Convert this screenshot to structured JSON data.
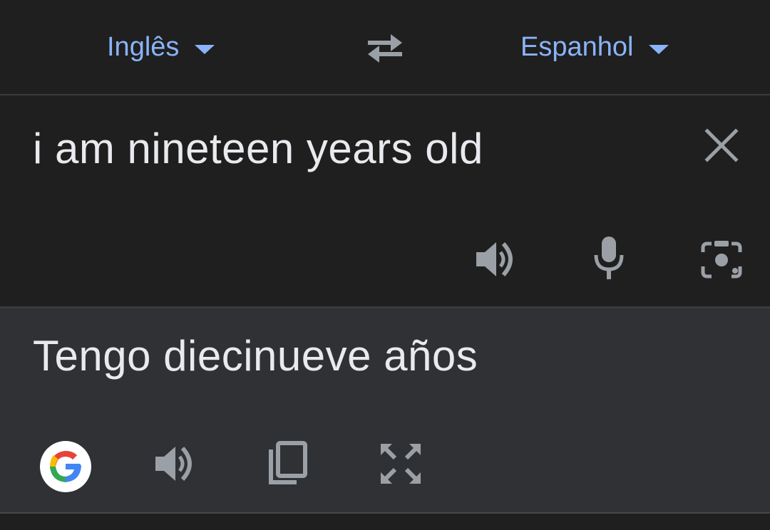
{
  "language_bar": {
    "source_language": "Inglês",
    "target_language": "Espanhol"
  },
  "input": {
    "text": "i am nineteen years old"
  },
  "output": {
    "text": "Tengo diecinueve años"
  },
  "icons": {
    "swap": "swap-arrows-icon",
    "clear": "close-icon",
    "listen_input": "speaker-icon",
    "voice": "microphone-icon",
    "camera": "camera-icon",
    "google": "google-logo-icon",
    "listen_output": "speaker-icon",
    "copy": "copy-icon",
    "fullscreen": "fullscreen-icon"
  },
  "colors": {
    "accent": "#8ab4f8",
    "text": "#e8eaed",
    "icon": "#9aa0a6",
    "input_bg": "#1f1f1f",
    "output_bg": "#303134"
  }
}
